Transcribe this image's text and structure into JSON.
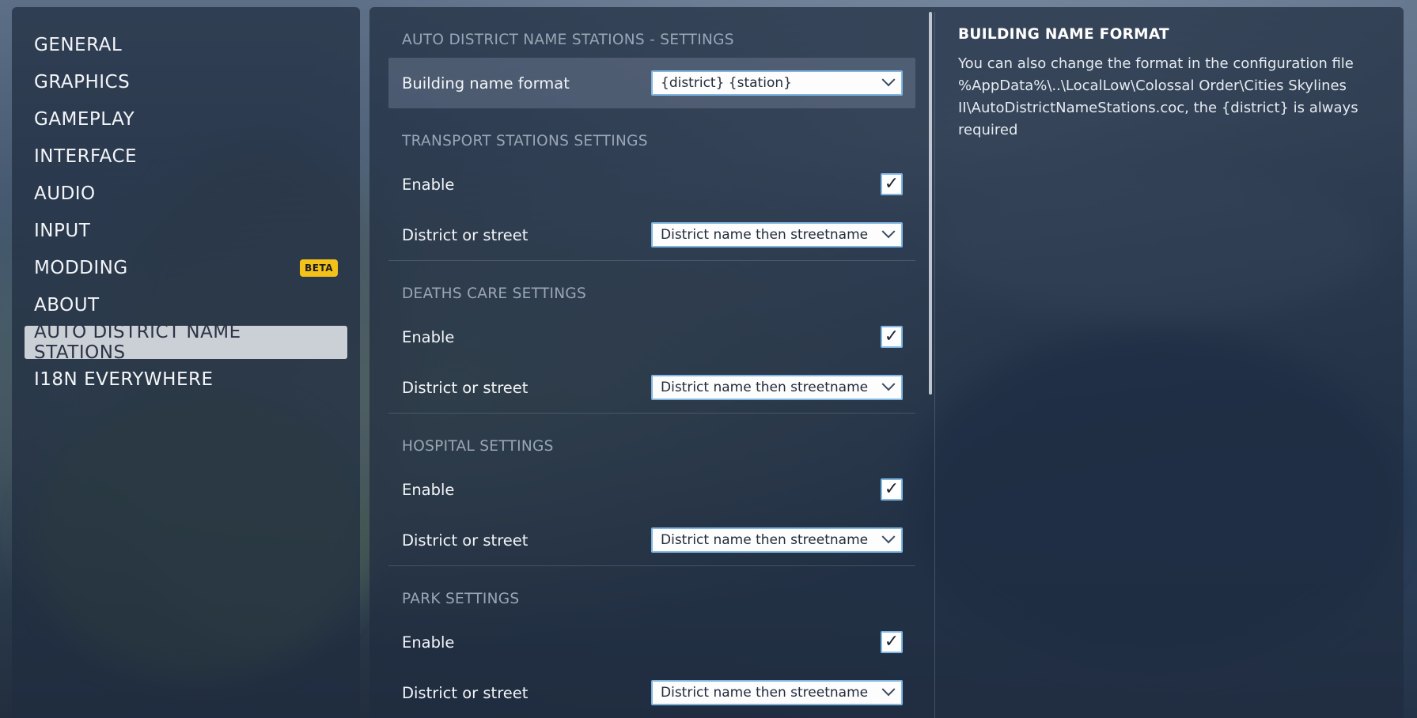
{
  "sidebar": {
    "items": [
      {
        "label": "GENERAL",
        "active": false
      },
      {
        "label": "GRAPHICS",
        "active": false
      },
      {
        "label": "GAMEPLAY",
        "active": false
      },
      {
        "label": "INTERFACE",
        "active": false
      },
      {
        "label": "AUDIO",
        "active": false
      },
      {
        "label": "INPUT",
        "active": false
      },
      {
        "label": "MODDING",
        "active": false,
        "badge": "BETA"
      },
      {
        "label": "ABOUT",
        "active": false
      },
      {
        "label": "AUTO DISTRICT NAME STATIONS",
        "active": true
      },
      {
        "label": "I18N EVERYWHERE",
        "active": false
      }
    ]
  },
  "settings": {
    "main_title": "AUTO DISTRICT NAME STATIONS - SETTINGS",
    "building_format": {
      "label": "Building name format",
      "value": "{district} {station}"
    },
    "sections": [
      {
        "title": "TRANSPORT STATIONS SETTINGS",
        "enable_label": "Enable",
        "enabled": true,
        "mode_label": "District or street",
        "mode_value": "District name then streetname"
      },
      {
        "title": "DEATHS CARE SETTINGS",
        "enable_label": "Enable",
        "enabled": true,
        "mode_label": "District or street",
        "mode_value": "District name then streetname"
      },
      {
        "title": "HOSPITAL SETTINGS",
        "enable_label": "Enable",
        "enabled": true,
        "mode_label": "District or street",
        "mode_value": "District name then streetname"
      },
      {
        "title": "PARK SETTINGS",
        "enable_label": "Enable",
        "enabled": true,
        "mode_label": "District or street",
        "mode_value": "District name then streetname"
      }
    ]
  },
  "info": {
    "title": "BUILDING NAME FORMAT",
    "text": "You can also change the format in the configuration file %AppData%\\..\\LocalLow\\Colossal Order\\Cities Skylines II\\AutoDistrictNameStations.coc, the {district} is always required"
  },
  "icons": {
    "check": "checkmark-icon",
    "dropdown": "chevron-down-icon"
  }
}
